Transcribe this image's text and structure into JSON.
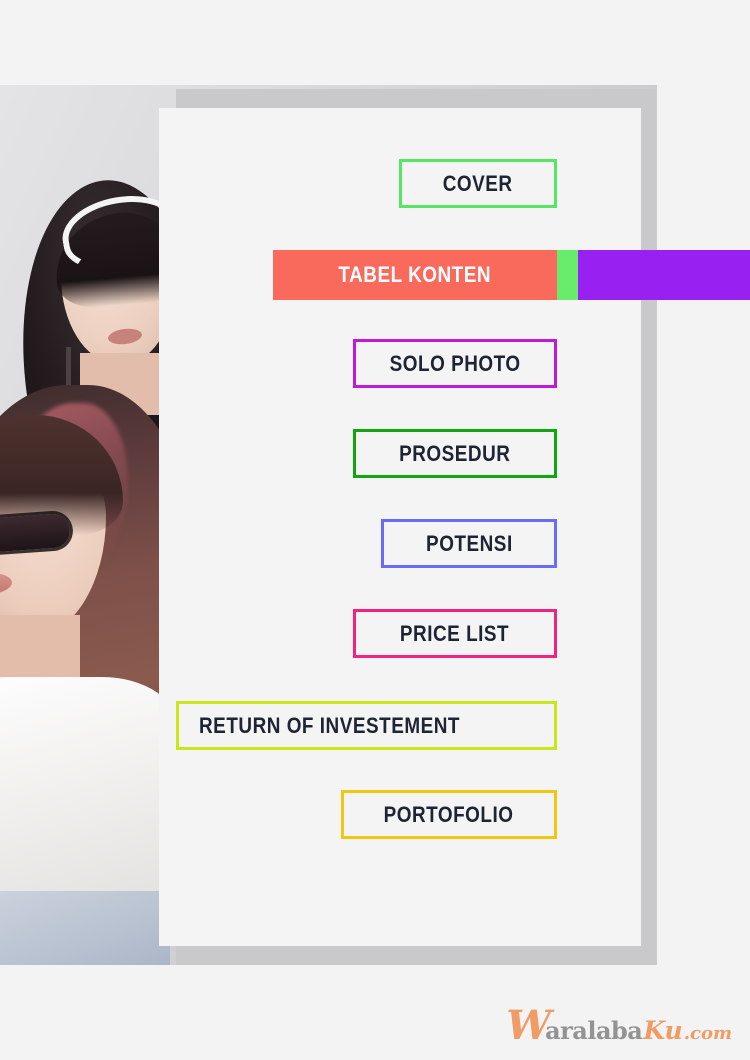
{
  "page": {
    "background_color": "#f3f3f3",
    "panel_color": "#f4f4f4"
  },
  "photo": {
    "alt_name": "three-women-studio-photo"
  },
  "menu": {
    "items": [
      {
        "id": "cover",
        "label": "COVER",
        "border_color": "#56e663",
        "text_color": "#1d2433",
        "state": "normal"
      },
      {
        "id": "tabel",
        "label": "TABEL KONTEN",
        "border_color": "#fa6a5c",
        "text_color": "#ffffff",
        "state": "active"
      },
      {
        "id": "solo",
        "label": "SOLO PHOTO",
        "border_color": "#c01ad8",
        "text_color": "#1d2433",
        "state": "normal"
      },
      {
        "id": "prosedur",
        "label": "PROSEDUR",
        "border_color": "#11a50f",
        "text_color": "#1d2433",
        "state": "normal"
      },
      {
        "id": "potensi",
        "label": "POTENSI",
        "border_color": "#6a6cf5",
        "text_color": "#1d2433",
        "state": "normal"
      },
      {
        "id": "price",
        "label": "PRICE LIST",
        "border_color": "#f2237f",
        "text_color": "#1d2433",
        "state": "normal"
      },
      {
        "id": "return",
        "label": "RETURN OF INVESTEMENT",
        "border_color": "#c9e619",
        "text_color": "#1d2433",
        "state": "normal"
      },
      {
        "id": "portofolio",
        "label": "PORTOFOLIO",
        "border_color": "#f2c80f",
        "text_color": "#1d2433",
        "state": "normal"
      }
    ]
  },
  "active_bar": {
    "label": "TABEL KONTEN",
    "red_color": "#fa6a5c",
    "green_color": "#69ec6b",
    "purple_color": "#9821f2"
  },
  "watermark": {
    "w": "W",
    "aralaba": "aralaba",
    "ku": "Ku",
    "com": ".com",
    "orange": "#f0955c",
    "gray": "#8b8b8b"
  }
}
